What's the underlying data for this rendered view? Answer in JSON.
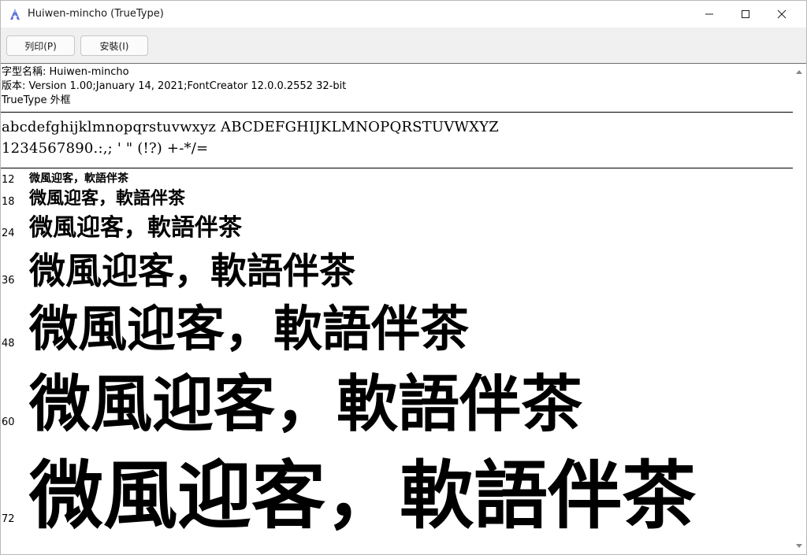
{
  "window": {
    "title": "Huiwen-mincho (TrueType)",
    "app_icon": "font-viewer-icon",
    "controls": {
      "minimize_icon": "minimize-icon",
      "maximize_icon": "maximize-icon",
      "close_icon": "close-icon"
    }
  },
  "toolbar": {
    "print_label": "列印(P)",
    "install_label": "安裝(I)"
  },
  "font_info": {
    "name_line": "字型名稱: Huiwen-mincho",
    "version_line": "版本: Version 1.00;January 14, 2021;FontCreator 12.0.0.2552 32-bit",
    "type_line": "TrueType 外框"
  },
  "character_set": {
    "letters": "abcdefghijklmnopqrstuvwxyz ABCDEFGHIJKLMNOPQRSTUVWXYZ",
    "digits_symbols": "1234567890.:,; ' \" (!?) +-*/="
  },
  "sample_text": "微風迎客，軟語伴茶",
  "sizes": [
    {
      "label": "12"
    },
    {
      "label": "18"
    },
    {
      "label": "24"
    },
    {
      "label": "36"
    },
    {
      "label": "48"
    },
    {
      "label": "60"
    },
    {
      "label": "72"
    }
  ]
}
